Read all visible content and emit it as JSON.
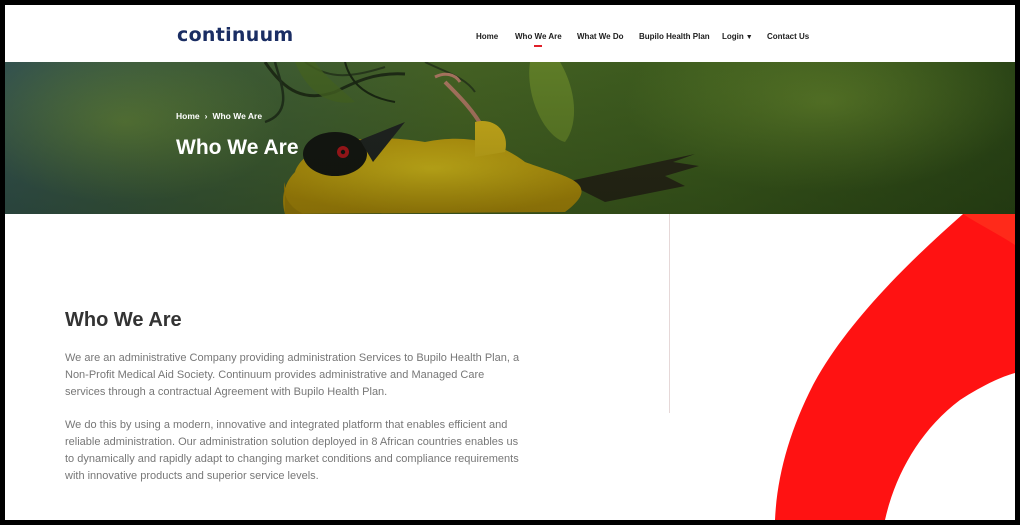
{
  "brand": {
    "logo_text": "continuum",
    "accent_color": "#e0202a",
    "navy": "#1a2d63"
  },
  "nav": {
    "items": [
      {
        "label": "Home"
      },
      {
        "label": "Who We Are"
      },
      {
        "label": "What We Do"
      },
      {
        "label": "Bupilo Health Plan"
      },
      {
        "label": "Login"
      },
      {
        "label": "Contact Us"
      }
    ]
  },
  "hero": {
    "breadcrumb": {
      "home": "Home",
      "current": "Who We Are",
      "separator": "›"
    },
    "title": "Who We Are",
    "image": "weaver-bird-photo"
  },
  "main": {
    "title": "Who We Are",
    "paragraphs": [
      "We are an administrative Company providing administration Services to Bupilo Health Plan, a Non-Profit Medical Aid Society. Continuum provides administrative and Managed Care services through a contractual Agreement with Bupilo Health Plan.",
      "We do this by using a modern, innovative and integrated platform that enables efficient and reliable administration. Our administration solution deployed in 8 African countries enables us to dynamically and rapidly adapt to changing market conditions and compliance requirements with innovative products and superior service levels."
    ]
  }
}
